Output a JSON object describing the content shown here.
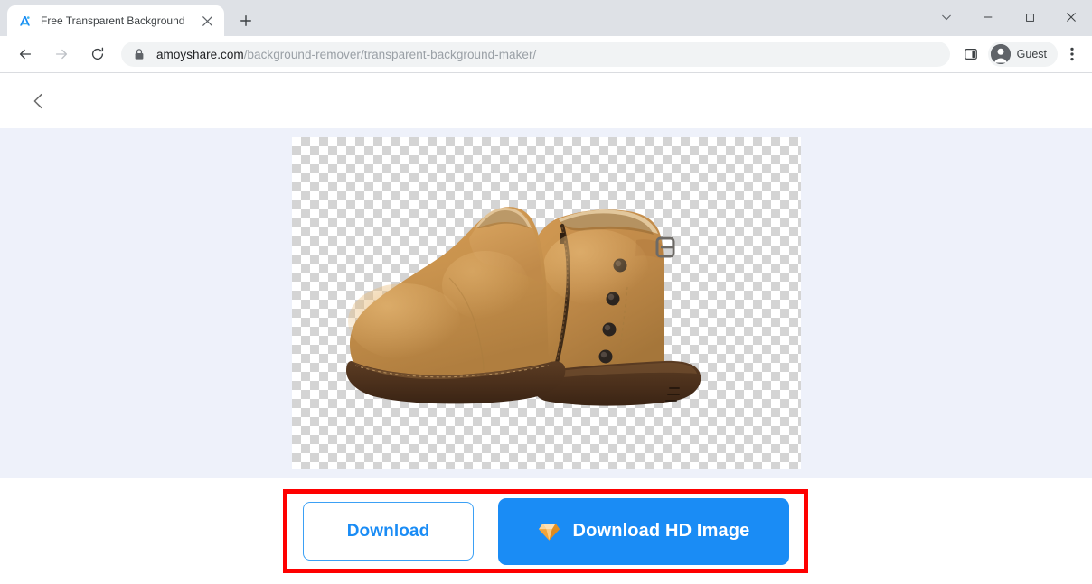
{
  "browser": {
    "tab": {
      "title": "Free Transparent Background ",
      "favicon_name": "amoyshare-logo-icon",
      "close_label": "×"
    },
    "new_tab_label": "+",
    "window_controls": {
      "tab_search": "tab-search-chevron",
      "minimize": "minimize",
      "maximize": "maximize",
      "close": "close"
    },
    "toolbar": {
      "back": "back-arrow",
      "forward": "forward-arrow",
      "reload": "reload",
      "lock": "lock-icon",
      "url_host": "amoyshare.com",
      "url_path": "/background-remover/transparent-background-maker/",
      "side_panel": "side-panel-icon",
      "profile_label": "Guest",
      "menu": "three-dot-menu"
    }
  },
  "page": {
    "header": {
      "back_chevron": "back-chevron-icon"
    },
    "canvas": {
      "alt": "Pair of tan leather ankle boots on transparent checkerboard background",
      "transparency_pattern": "checkerboard",
      "checker_light": "#ffffff",
      "checker_dark": "#d4d4d4"
    },
    "actions": {
      "download_label": "Download",
      "download_hd_label": "Download HD Image",
      "hd_icon_name": "gem-diamond-icon"
    },
    "annotation": {
      "highlight_color": "#fe0000",
      "shape": "rectangle"
    },
    "colors": {
      "accent_blue": "#1a8cf5",
      "content_bg": "#eef1fa",
      "page_bg": "#ffffff"
    }
  }
}
